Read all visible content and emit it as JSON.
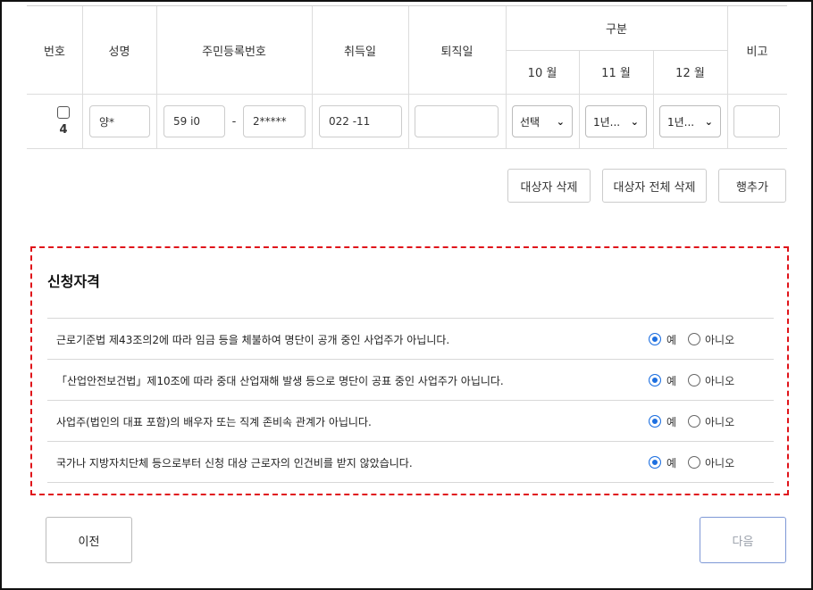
{
  "table": {
    "headers": {
      "number": "번호",
      "name": "성명",
      "resident_number": "주민등록번호",
      "hire_date": "취득일",
      "leave_date": "퇴직일",
      "category": "구분",
      "months": [
        "10 월",
        "11 월",
        "12 월"
      ],
      "note": "비고"
    },
    "row": {
      "index": "4",
      "name": "양*",
      "resident_front": "59     i0",
      "dash": "-",
      "resident_back": "2*****",
      "hire_date": "022     -11",
      "leave_date": "",
      "month_values": [
        "선택",
        "1년...",
        "1년..."
      ],
      "note": ""
    }
  },
  "actions": {
    "delete_selected": "대상자 삭제",
    "delete_all": "대상자 전체 삭제",
    "add_row": "행추가"
  },
  "eligibility": {
    "title": "신청자격",
    "yes_label": "예",
    "no_label": "아니오",
    "questions": [
      {
        "text": "근로기준법 제43조의2에 따라 임금 등을 체불하여 명단이 공개 중인 사업주가 아닙니다.",
        "selected": "예"
      },
      {
        "text": "「산업안전보건법」제10조에 따라 중대 산업재해 발생 등으로 명단이 공표 중인 사업주가 아닙니다.",
        "selected": "예"
      },
      {
        "text": "사업주(법인의 대표 포함)의 배우자 또는 직계 존비속 관계가 아닙니다.",
        "selected": "예"
      },
      {
        "text": "국가나 지방자치단체 등으로부터 신청 대상 근로자의 인건비를 받지 않았습니다.",
        "selected": "예"
      }
    ]
  },
  "nav": {
    "prev": "이전",
    "next": "다음"
  },
  "colors": {
    "accent": "#1d6fe0",
    "highlight_border": "#e0141a",
    "disabled_text": "#9aa0aa"
  }
}
